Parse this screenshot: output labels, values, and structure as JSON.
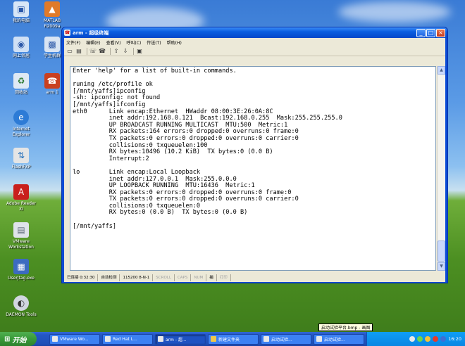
{
  "desktop": {
    "icons": [
      {
        "label": "我的电脑",
        "icon": "computer-icon"
      },
      {
        "label": "网上邻居",
        "icon": "network-icon"
      },
      {
        "label": "回收站",
        "icon": "recycle-bin-icon"
      },
      {
        "label": "Internet\nExplorer",
        "icon": "ie-icon"
      },
      {
        "label": "FlashFXP",
        "icon": "flashfxp-icon"
      },
      {
        "label": "Adobe Reader\nXI",
        "icon": "adobe-reader-icon"
      },
      {
        "label": "VMware\nWorkstation",
        "icon": "vmware-icon"
      },
      {
        "label": "Userjtag.exe",
        "icon": "usbjtag-icon"
      },
      {
        "label": "DAEMON Tools",
        "icon": "daemon-tools-icon"
      },
      {
        "label": "MATLAB\nR2009a",
        "icon": "matlab-icon"
      },
      {
        "label": "学生机群",
        "icon": "students-icon"
      },
      {
        "label": "arm 1",
        "icon": "arm-icon"
      }
    ]
  },
  "window": {
    "title": "arm - 超级终端",
    "menu": [
      "文件(F)",
      "编辑(E)",
      "查看(V)",
      "呼叫(C)",
      "传送(T)",
      "帮助(H)"
    ],
    "terminal_text": "Enter 'help' for a list of built-in commands.\n\nruning /etc/profile ok\n[/mnt/yaffs]ipconfig\n-sh: ipconfig: not found\n[/mnt/yaffs]ifconfig\neth0      Link encap:Ethernet  HWaddr 08:00:3E:26:0A:8C\n          inet addr:192.168.0.121  Bcast:192.168.0.255  Mask:255.255.255.0\n          UP BROADCAST RUNNING MULTICAST  MTU:500  Metric:1\n          RX packets:164 errors:0 dropped:0 overruns:0 frame:0\n          TX packets:0 errors:0 dropped:0 overruns:0 carrier:0\n          collisions:0 txqueuelen:100\n          RX bytes:10496 (10.2 KiB)  TX bytes:0 (0.0 B)\n          Interrupt:2\n\nlo        Link encap:Local Loopback\n          inet addr:127.0.0.1  Mask:255.0.0.0\n          UP LOOPBACK RUNNING  MTU:16436  Metric:1\n          RX packets:0 errors:0 dropped:0 overruns:0 frame:0\n          TX packets:0 errors:0 dropped:0 overruns:0 carrier:0\n          collisions:0 txqueuelen:0\n          RX bytes:0 (0.0 B)  TX bytes:0 (0.0 B)\n\n[/mnt/yaffs]",
    "status": {
      "connected": "已连接 0:32:30",
      "detect": "自动检测",
      "baud": "115200 8-N-1",
      "scroll": "SCROLL",
      "caps": "CAPS",
      "num": "NUM",
      "capture": "捕",
      "echo": "打印"
    }
  },
  "taskbar": {
    "start_label": "开始",
    "tasks": [
      {
        "label": "VMware Wo..."
      },
      {
        "label": "Red Hat L..."
      },
      {
        "label": "arm - 超..."
      },
      {
        "label": "新建文件夹"
      },
      {
        "label": "启动试验..."
      },
      {
        "label": "启动试验..."
      }
    ],
    "clock": "16:20"
  },
  "tooltip": "启动试验平台.bmp - 画图"
}
